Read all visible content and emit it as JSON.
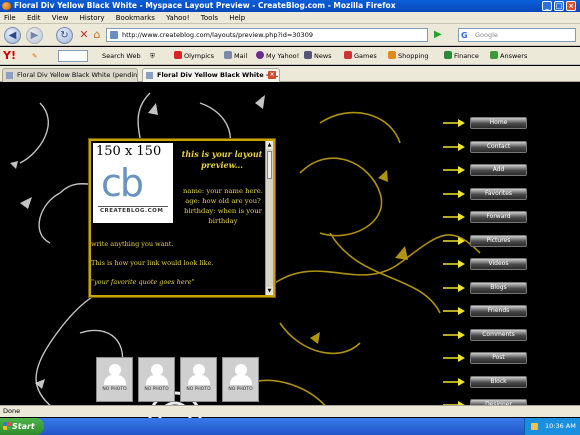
{
  "window": {
    "title": "Floral Div Yellow Black White - Myspace Layout Preview - CreateBlog.com - Mozilla Firefox"
  },
  "menu": [
    "File",
    "Edit",
    "View",
    "History",
    "Bookmarks",
    "Yahoo!",
    "Tools",
    "Help"
  ],
  "nav": {
    "url": "http://www.createblog.com/layouts/preview.php?id=30309",
    "search_placeholder": "Google"
  },
  "yahoo_toolbar": {
    "items": [
      "Search Web",
      "Olympics",
      "Mail",
      "My Yahoo!",
      "News",
      "Games",
      "Shopping",
      "Finance",
      "Answers"
    ]
  },
  "tabs": [
    {
      "label": "Floral Div Yellow Black White (pending)...",
      "active": false
    },
    {
      "label": "Floral Div Yellow Black White - ...",
      "active": true
    }
  ],
  "profile": {
    "photo_size": "150 x 150",
    "logo_mark": "cb",
    "logo_text": "CREATEBLOG.COM",
    "title": "this is your layout preview...",
    "info": "name: your name here. age: how old are you? birthday: when is your birthday",
    "line1": "write anything you want.",
    "line2": "This is how your link would look like.",
    "quote": "\"your favorite quote goes here\""
  },
  "thumbs": [
    "NO PHOTO",
    "NO PHOTO",
    "NO PHOTO",
    "NO PHOTO"
  ],
  "side_menu": [
    "Home",
    "Contact",
    "Add",
    "Favorites",
    "Forward",
    "Pictures",
    "Videos",
    "Blogs",
    "Friends",
    "Comments",
    "Post",
    "Block",
    "Designer"
  ],
  "status": {
    "text": "Done"
  },
  "taskbar": {
    "start": "Start",
    "clock": "10:36 AM"
  },
  "colors": {
    "accent": "#e8d24a",
    "background": "#000000",
    "frame": "#c9a400"
  }
}
